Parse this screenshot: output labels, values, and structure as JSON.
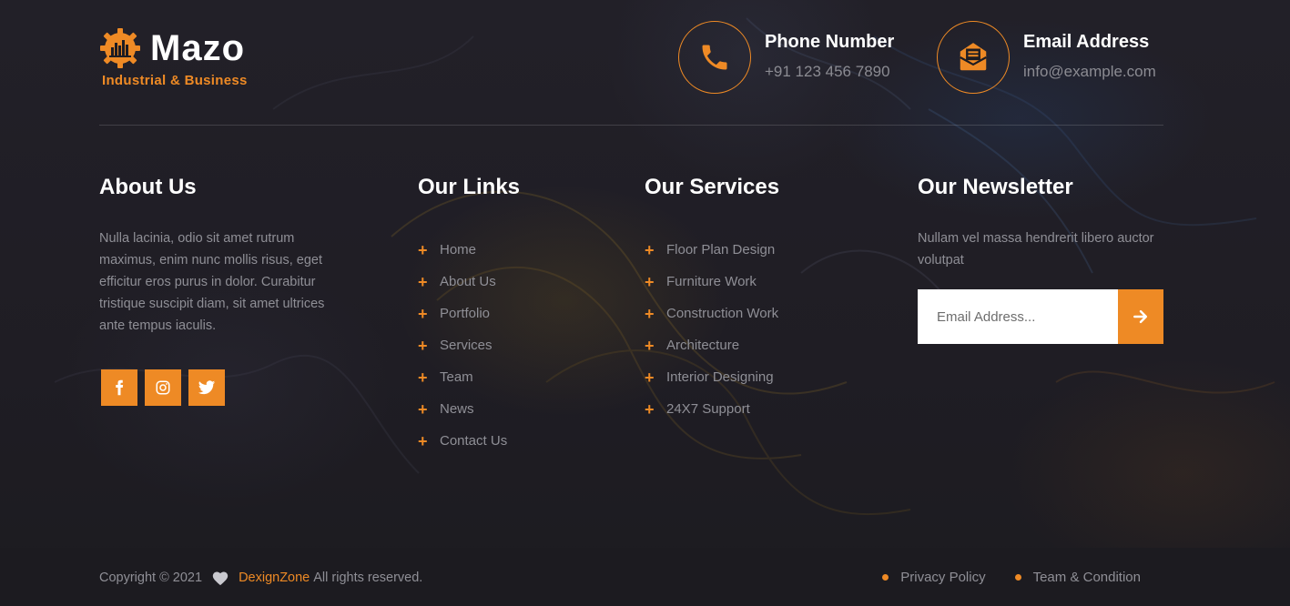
{
  "brand": {
    "name": "Mazo",
    "tagline": "Industrial & Business"
  },
  "contacts": {
    "phone": {
      "title": "Phone Number",
      "value": "+91 123 456 7890",
      "icon": "phone-icon"
    },
    "email": {
      "title": "Email Address",
      "value": "info@example.com",
      "icon": "envelope-icon"
    }
  },
  "about": {
    "title": "About Us",
    "text": "Nulla lacinia, odio sit amet rutrum maximus, enim nunc mollis risus, eget efficitur eros purus in dolor. Curabitur tristique suscipit diam, sit amet ultrices ante tempus iaculis.",
    "social": [
      "facebook-icon",
      "instagram-icon",
      "twitter-icon"
    ]
  },
  "links": {
    "title": "Our Links",
    "items": [
      "Home",
      "About Us",
      "Portfolio",
      "Services",
      "Team",
      "News",
      "Contact Us"
    ]
  },
  "services": {
    "title": "Our Services",
    "items": [
      "Floor Plan Design",
      "Furniture Work",
      "Construction Work",
      "Architecture",
      "Interior Designing",
      "24X7 Support"
    ]
  },
  "newsletter": {
    "title": "Our Newsletter",
    "text": "Nullam vel massa hendrerit libero auctor volutpat",
    "placeholder": "Email Address...",
    "submit_icon": "arrow-right-icon"
  },
  "footer": {
    "copyright": "Copyright © 2021",
    "company": "DexignZone",
    "rights": "All rights reserved.",
    "legal": [
      "Privacy Policy",
      "Team & Condition"
    ]
  },
  "colors": {
    "accent": "#ee8a25",
    "background": "#1d1c22",
    "muted_text": "#8f8f96"
  }
}
